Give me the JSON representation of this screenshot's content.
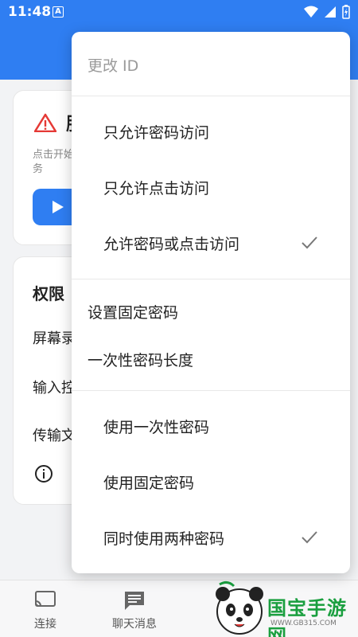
{
  "status_bar": {
    "time": "11:48",
    "notification_icon": "A"
  },
  "background": {
    "service_card": {
      "title": "服",
      "description": "点击开始服务"
    },
    "permissions_card": {
      "title": "权限",
      "items": [
        "屏幕录",
        "输入控",
        "传输文"
      ]
    }
  },
  "menu": {
    "items": [
      {
        "label": "更改 ID",
        "disabled": true
      },
      {
        "label": "只允许密码访问"
      },
      {
        "label": "只允许点击访问"
      },
      {
        "label": "允许密码或点击访问",
        "checked": true
      },
      {
        "label": "设置固定密码"
      },
      {
        "label": "一次性密码长度"
      },
      {
        "label": "使用一次性密码"
      },
      {
        "label": "使用固定密码"
      },
      {
        "label": "同时使用两种密码",
        "checked": true
      }
    ]
  },
  "bottom_nav": {
    "items": [
      {
        "label": "连接",
        "icon": "cast-icon"
      },
      {
        "label": "聊天消息",
        "icon": "chat-icon"
      }
    ]
  },
  "watermark": {
    "text": "国宝手游网",
    "url": "WWW.GB315.COM"
  },
  "colors": {
    "primary": "#2f7ef2",
    "warning": "#e53935",
    "watermark_green": "#1a9f3f"
  }
}
